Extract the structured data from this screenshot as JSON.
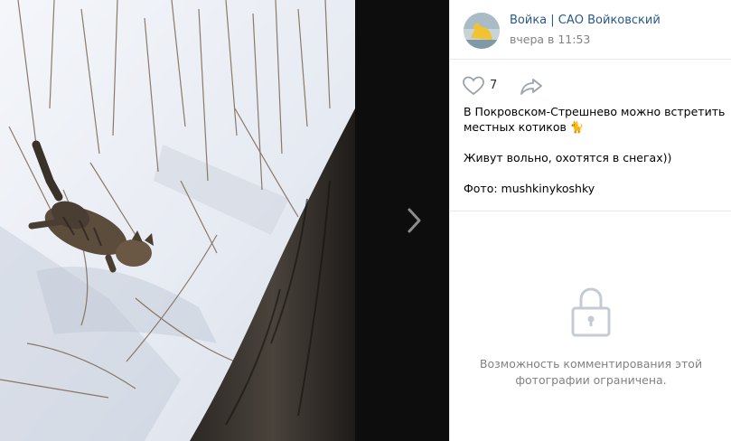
{
  "post": {
    "author": "Войка | САО Войковский",
    "time": "вчера в 11:53",
    "likes": "7",
    "text_line1": "В Покровском-Стрешнево можно встретить местных котиков 🐈",
    "text_line2": "Живут вольно, охотятся в снегах))",
    "text_line3": "Фото: mushkinykoshky"
  },
  "comments": {
    "notice": "Возможность комментирования этой фотографии ограничена."
  },
  "icons": {
    "like": "heart-icon",
    "share": "share-arrow-icon",
    "next": "chevron-right-icon",
    "lock": "lock-icon"
  },
  "colors": {
    "link": "#2a5885",
    "muted": "#828282",
    "divider": "#e7e8ec",
    "icon": "#99a2ad"
  }
}
